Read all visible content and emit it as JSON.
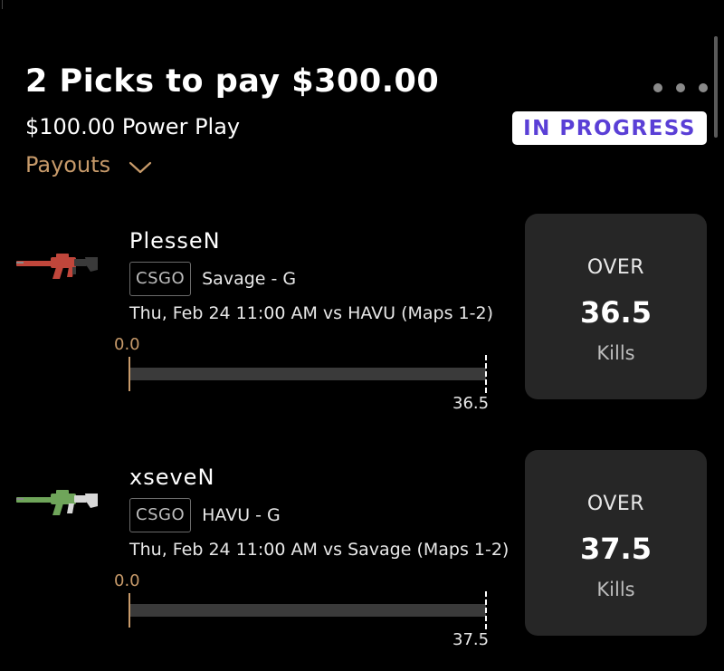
{
  "header": {
    "title": "2 Picks to pay $300.00",
    "subtitle": "$100.00 Power Play",
    "payouts_label": "Payouts",
    "status": "IN PROGRESS",
    "more_icon": "more-dots-icon",
    "payouts_icon": "chevron-down-icon"
  },
  "picks": [
    {
      "player": "PlesseN",
      "league": "CSGO",
      "team_pos": "Savage - G",
      "game": "Thu, Feb 24 11:00 AM vs HAVU (Maps 1-2)",
      "progress_start": "0.0",
      "progress_target": "36.5",
      "progress_fraction": 0,
      "direction": "OVER",
      "line": "36.5",
      "stat": "Kills",
      "icon": "rifle-icon",
      "icon_color": "#c0463b"
    },
    {
      "player": "xseveN",
      "league": "CSGO",
      "team_pos": "HAVU - G",
      "game": "Thu, Feb 24 11:00 AM vs Savage (Maps 1-2)",
      "progress_start": "0.0",
      "progress_target": "37.5",
      "progress_fraction": 0,
      "direction": "OVER",
      "line": "37.5",
      "stat": "Kills",
      "icon": "rifle-icon",
      "icon_color": "#6fa55a"
    }
  ],
  "colors": {
    "accent": "#c79a6a",
    "status_text": "#5a3fd6",
    "card_bg": "#262626",
    "track": "#3a3a3a"
  }
}
